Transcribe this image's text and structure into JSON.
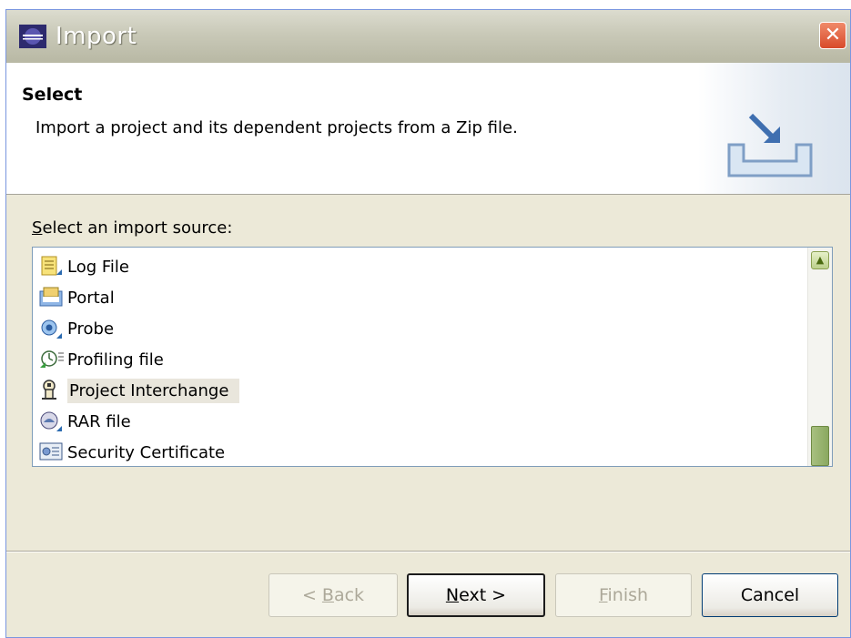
{
  "window": {
    "title": "Import",
    "close_label": "✕"
  },
  "header": {
    "title": "Select",
    "description": "Import a project and its dependent projects from a Zip file."
  },
  "source_label": {
    "mnemonic": "S",
    "rest": "elect an import source:"
  },
  "list": {
    "items": [
      {
        "label": "Log File",
        "icon": "log-file-icon"
      },
      {
        "label": "Portal",
        "icon": "portal-icon"
      },
      {
        "label": "Probe",
        "icon": "probe-icon"
      },
      {
        "label": "Profiling file",
        "icon": "profiling-file-icon"
      },
      {
        "label": "Project Interchange",
        "icon": "project-interchange-icon",
        "selected": true
      },
      {
        "label": "RAR file",
        "icon": "rar-file-icon"
      },
      {
        "label": "Security Certificate",
        "icon": "security-certificate-icon"
      }
    ]
  },
  "buttons": {
    "back": {
      "mnemonic": "B",
      "pre": "< ",
      "rest": "ack",
      "enabled": false
    },
    "next": {
      "mnemonic": "N",
      "pre": "",
      "rest": "ext >",
      "enabled": true
    },
    "finish": {
      "mnemonic": "F",
      "pre": "",
      "rest": "inish",
      "enabled": false
    },
    "cancel": {
      "label": "Cancel",
      "enabled": true
    }
  },
  "colors": {
    "dialog_bg": "#ece9d8",
    "selection_bg": "#e9e6dc",
    "disabled_text": "#aca899"
  }
}
